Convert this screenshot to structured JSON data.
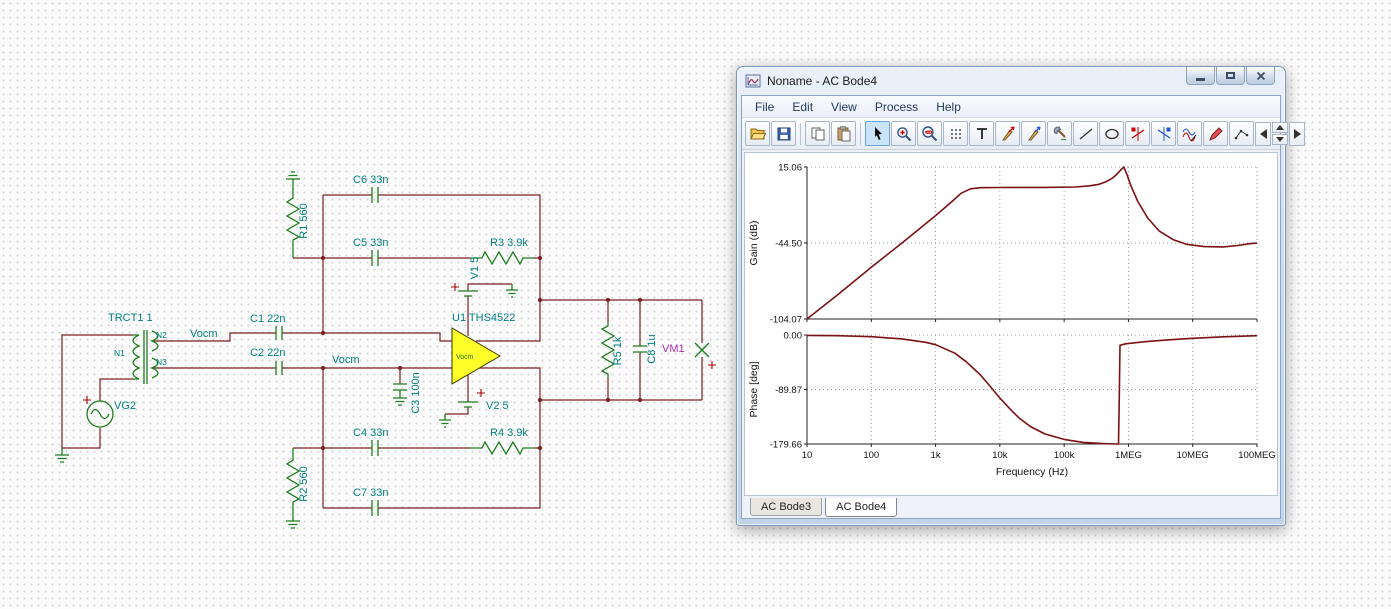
{
  "schematic": {
    "labels": {
      "transformer": "TRCT1 1",
      "n1": "N1",
      "n2": "N2",
      "n3": "N3",
      "source": "VG2",
      "r1": "R1 560",
      "r2": "R2 560",
      "r3": "R3 3.9k",
      "r4": "R4 3.9k",
      "r5": "R5 1k",
      "c1": "C1 22n",
      "c2": "C2 22n",
      "c3": "C3 100n",
      "c4": "C4 33n",
      "c5": "C5 33n",
      "c6": "C6 33n",
      "c7": "C7 33n",
      "c8": "C8 1u",
      "opamp": "U1 THS4522",
      "opamp_vocm": "Vocm",
      "v1": "V1 5",
      "v2": "V2 5",
      "vm1": "VM1",
      "vocm_top": "Vocm",
      "vocm_bottom": "Vocm"
    },
    "colors": {
      "wire": "#7a2020",
      "component": "#1e7d1e",
      "label": "#00807f",
      "opamp_fill": "#ffff29",
      "vm_label": "#b030b0"
    }
  },
  "window": {
    "title": "Noname - AC Bode4",
    "menu": [
      "File",
      "Edit",
      "View",
      "Process",
      "Help"
    ],
    "controls": [
      "minimize",
      "maximize",
      "close"
    ],
    "toolbar_icons": [
      "open",
      "save",
      "copy",
      "paste",
      "select",
      "zoom-in",
      "zoom-100",
      "grid",
      "text",
      "voltage-probe",
      "current-probe",
      "separate-curves",
      "line",
      "ellipse",
      "cursor-a",
      "cursor-b",
      "export-curves",
      "marker",
      "polyline",
      "scroll-left",
      "spin-up",
      "spin-down",
      "scroll-right"
    ],
    "tabs": [
      {
        "label": "AC Bode3",
        "active": false
      },
      {
        "label": "AC Bode4",
        "active": true
      }
    ]
  },
  "chart_data": [
    {
      "type": "line",
      "title": "Gain",
      "ylabel": "Gain (dB)",
      "xlabel": "",
      "xscale": "log",
      "xlim": [
        10,
        100000000
      ],
      "ylim": [
        -104.07,
        15.06
      ],
      "grid": true,
      "yticks": [
        {
          "v": 15.06,
          "label": "15.06"
        },
        {
          "v": -44.5,
          "label": "-44.50"
        },
        {
          "v": -104.07,
          "label": "-104.07"
        }
      ],
      "xticks": [
        {
          "v": 10,
          "label": "10"
        },
        {
          "v": 100,
          "label": "100"
        },
        {
          "v": 1000,
          "label": "1k"
        },
        {
          "v": 10000,
          "label": "10k"
        },
        {
          "v": 100000,
          "label": "100k"
        },
        {
          "v": 1000000,
          "label": "1MEG"
        },
        {
          "v": 10000000,
          "label": "10MEG"
        },
        {
          "v": 100000000,
          "label": "100MEG"
        }
      ],
      "series": [
        {
          "name": "gain",
          "color": "#7b1113",
          "points": [
            [
              10,
              -104.07
            ],
            [
              30,
              -85
            ],
            [
              100,
              -63.5
            ],
            [
              300,
              -44.5
            ],
            [
              1000,
              -23
            ],
            [
              1800,
              -12
            ],
            [
              2500,
              -5.5
            ],
            [
              3500,
              -2
            ],
            [
              5000,
              -1.2
            ],
            [
              10000,
              -1.0
            ],
            [
              50000,
              -0.9
            ],
            [
              150000,
              -0.6
            ],
            [
              250000,
              0.3
            ],
            [
              350000,
              1.5
            ],
            [
              450000,
              3.5
            ],
            [
              550000,
              6
            ],
            [
              650000,
              9
            ],
            [
              750000,
              12.5
            ],
            [
              850000,
              15.06
            ],
            [
              950000,
              9
            ],
            [
              1100000,
              0
            ],
            [
              1400000,
              -12
            ],
            [
              2000000,
              -25
            ],
            [
              3000000,
              -35
            ],
            [
              5000000,
              -42
            ],
            [
              8000000,
              -45.5
            ],
            [
              15000000,
              -47.3
            ],
            [
              30000000,
              -47.6
            ],
            [
              50000000,
              -46.5
            ],
            [
              80000000,
              -45
            ],
            [
              100000000,
              -44.6
            ]
          ]
        }
      ]
    },
    {
      "type": "line",
      "title": "Phase",
      "ylabel": "Phase [deg]",
      "xlabel": "Frequency (Hz)",
      "xscale": "log",
      "xlim": [
        10,
        100000000
      ],
      "ylim": [
        -179.66,
        0.0
      ],
      "grid": true,
      "yticks": [
        {
          "v": 0,
          "label": "0.00"
        },
        {
          "v": -89.87,
          "label": "-89.87"
        },
        {
          "v": -179.66,
          "label": "-179.66"
        }
      ],
      "xticks": [
        {
          "v": 10,
          "label": "10"
        },
        {
          "v": 100,
          "label": "100"
        },
        {
          "v": 1000,
          "label": "1k"
        },
        {
          "v": 10000,
          "label": "10k"
        },
        {
          "v": 100000,
          "label": "100k"
        },
        {
          "v": 1000000,
          "label": "1MEG"
        },
        {
          "v": 10000000,
          "label": "10MEG"
        },
        {
          "v": 100000000,
          "label": "100MEG"
        }
      ],
      "series": [
        {
          "name": "phase",
          "color": "#7b1113",
          "points": [
            [
              10,
              -0.6
            ],
            [
              30,
              -1.2
            ],
            [
              100,
              -2.8
            ],
            [
              300,
              -6.5
            ],
            [
              700,
              -12
            ],
            [
              1000,
              -16
            ],
            [
              2000,
              -30
            ],
            [
              3000,
              -44
            ],
            [
              5000,
              -66
            ],
            [
              7000,
              -84
            ],
            [
              10000,
              -104
            ],
            [
              15000,
              -124
            ],
            [
              20000,
              -137
            ],
            [
              30000,
              -151
            ],
            [
              50000,
              -163
            ],
            [
              100000,
              -172
            ],
            [
              200000,
              -177
            ],
            [
              400000,
              -179
            ],
            [
              650000,
              -179.66
            ],
            [
              700000,
              -179.66
            ],
            [
              720000,
              -100
            ],
            [
              740000,
              -17
            ],
            [
              900000,
              -14.5
            ],
            [
              1200000,
              -13
            ],
            [
              2000000,
              -10.5
            ],
            [
              4000000,
              -8
            ],
            [
              10000000,
              -5.5
            ],
            [
              30000000,
              -3
            ],
            [
              100000000,
              -1.2
            ]
          ]
        }
      ]
    }
  ]
}
